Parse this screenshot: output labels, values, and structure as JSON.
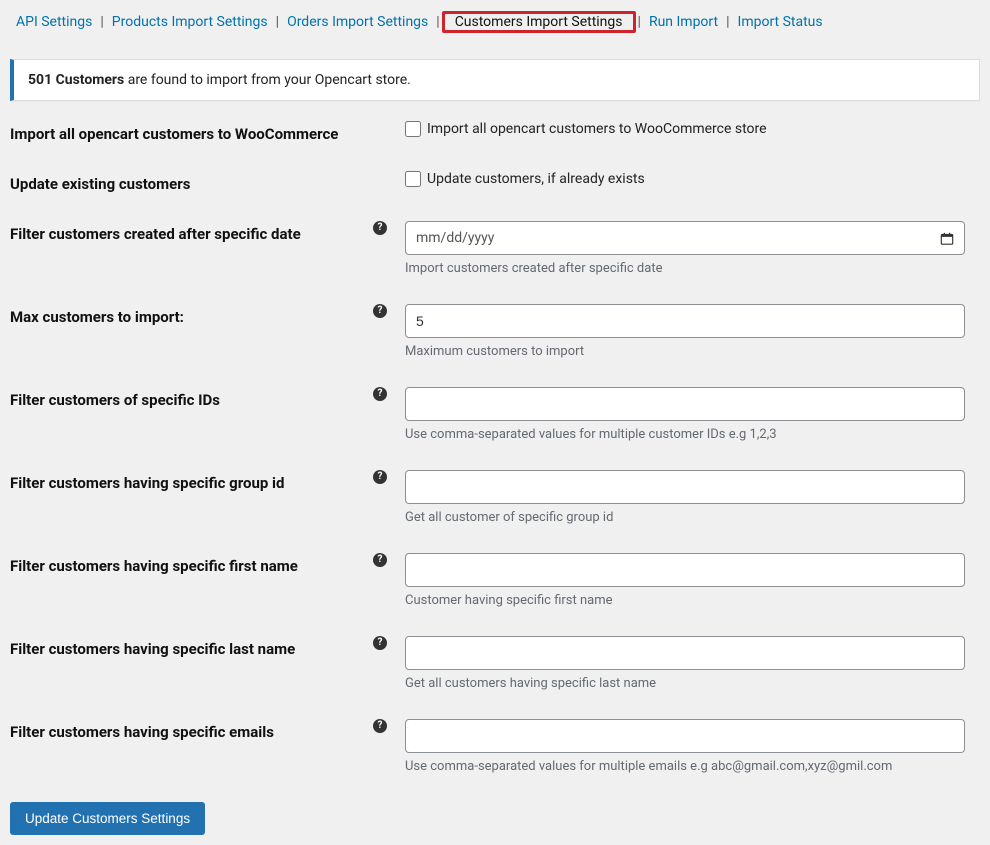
{
  "tabs": {
    "api": "API Settings",
    "products": "Products Import Settings",
    "orders": "Orders Import Settings",
    "customers": "Customers Import Settings",
    "run": "Run Import",
    "status": "Import Status"
  },
  "notice": {
    "count": "501 Customers",
    "text": " are found to import from your Opencart store."
  },
  "sections": {
    "import_all": {
      "label": "Import all opencart customers to WooCommerce",
      "checkbox_label": "Import all opencart customers to WooCommerce store"
    },
    "update_existing": {
      "label": "Update existing customers",
      "checkbox_label": "Update customers, if already exists"
    },
    "after_date": {
      "label": "Filter customers created after specific date",
      "placeholder": "mm/dd/yyyy",
      "helper": "Import customers created after specific date"
    },
    "max": {
      "label": "Max customers to import:",
      "value": "5",
      "helper": "Maximum customers to import"
    },
    "ids": {
      "label": "Filter customers of specific IDs",
      "helper": "Use comma-separated values for multiple customer IDs e.g 1,2,3"
    },
    "group": {
      "label": "Filter customers having specific group id",
      "helper": "Get all customer of specific group id"
    },
    "firstname": {
      "label": "Filter customers having specific first name",
      "helper": "Customer having specific first name"
    },
    "lastname": {
      "label": "Filter customers having specific last name",
      "helper": "Get all customers having specific last name"
    },
    "emails": {
      "label": "Filter customers having specific emails",
      "helper": "Use comma-separated values for multiple emails e.g abc@gmail.com,xyz@gmil.com"
    }
  },
  "submit_label": "Update Customers Settings",
  "help_glyph": "?"
}
